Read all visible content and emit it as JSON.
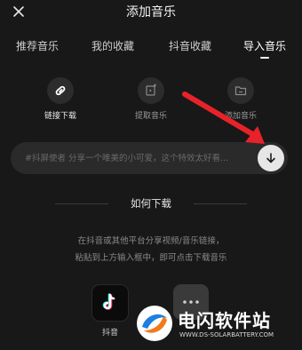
{
  "header": {
    "title": "添加音乐",
    "close_icon": "close-icon"
  },
  "tabs": [
    {
      "label": "推荐音乐",
      "active": false
    },
    {
      "label": "我的收藏",
      "active": false
    },
    {
      "label": "抖音收藏",
      "active": false
    },
    {
      "label": "导入音乐",
      "active": true
    }
  ],
  "sources": [
    {
      "label": "链接下载",
      "icon": "link-icon",
      "active": true
    },
    {
      "label": "提取音乐",
      "icon": "extract-video-icon",
      "active": false
    },
    {
      "label": "添加音乐",
      "icon": "folder-icon",
      "active": false
    }
  ],
  "link_input": {
    "placeholder": "#抖屏使者 分享一个唯美的小可爱，这个特效太好看...",
    "download_icon": "download-arrow-icon"
  },
  "howto": {
    "title": "如何下载",
    "line1": "在抖音或其他平台分享视频/音乐链接，",
    "line2": "粘贴到上方输入框中，即可点击下载音乐"
  },
  "apps": [
    {
      "label": "抖音",
      "icon": "douyin-icon"
    },
    {
      "label": "",
      "icon": "more-icon"
    }
  ],
  "watermark": {
    "title": "电闪软件站",
    "subtitle": "WWW.DS-SOLARBATTERY.COM"
  },
  "colors": {
    "background": "#181818",
    "accent_arrow": "#e8222a",
    "input_bg": "#2a2a2a"
  }
}
